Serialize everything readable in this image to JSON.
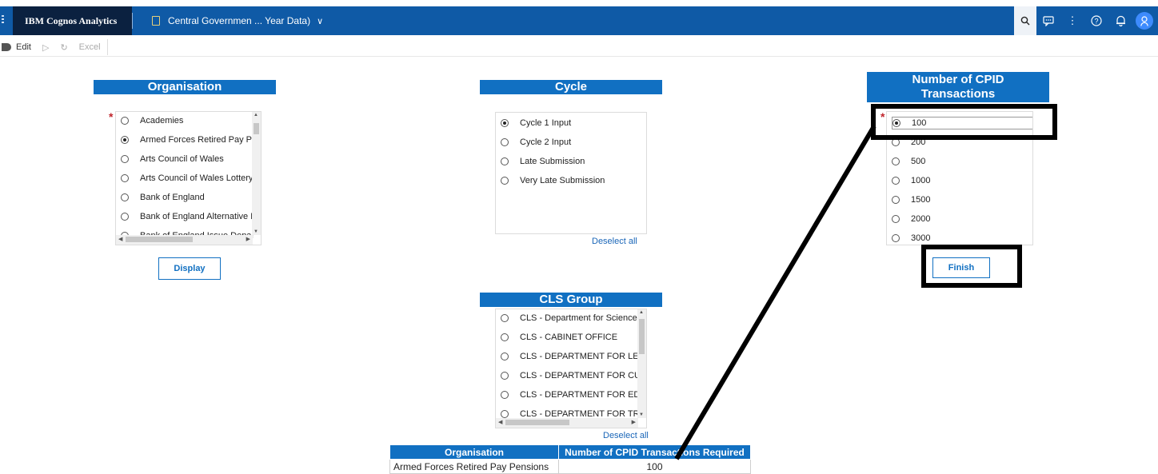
{
  "app": {
    "brand": "IBM Cognos Analytics",
    "report_title": "Central Governmen ... Year Data)"
  },
  "header_icons": [
    "search-icon",
    "comment-icon",
    "overflow-icon",
    "help-icon",
    "notification-icon",
    "user-icon"
  ],
  "toolbar": {
    "edit_label": "Edit",
    "excel_label": "Excel"
  },
  "organisation": {
    "title": "Organisation",
    "required_marker": "*",
    "options": [
      {
        "label": "Academies",
        "selected": false
      },
      {
        "label": "Armed Forces Retired Pay Pe",
        "selected": true
      },
      {
        "label": "Arts Council of Wales",
        "selected": false
      },
      {
        "label": "Arts Council of Wales Lottery",
        "selected": false
      },
      {
        "label": "Bank of England",
        "selected": false
      },
      {
        "label": "Bank of England Alternative L",
        "selected": false
      },
      {
        "label": "Bank of England Issue Depar",
        "selected": false
      }
    ],
    "display_button": "Display"
  },
  "cycle": {
    "title": "Cycle",
    "options": [
      {
        "label": "Cycle 1 Input",
        "selected": true
      },
      {
        "label": "Cycle 2 Input",
        "selected": false
      },
      {
        "label": "Late Submission",
        "selected": false
      },
      {
        "label": "Very Late Submission",
        "selected": false
      }
    ],
    "deselect_all": "Deselect all"
  },
  "cpid": {
    "title_line1": "Number of CPID",
    "title_line2": "Transactions",
    "required_marker": "*",
    "options": [
      {
        "label": "100",
        "selected": true
      },
      {
        "label": "200",
        "selected": false
      },
      {
        "label": "500",
        "selected": false
      },
      {
        "label": "1000",
        "selected": false
      },
      {
        "label": "1500",
        "selected": false
      },
      {
        "label": "2000",
        "selected": false
      },
      {
        "label": "3000",
        "selected": false
      }
    ],
    "finish_button": "Finish"
  },
  "cls_group": {
    "title": "CLS Group",
    "options": [
      {
        "label": "CLS - Department for Science,",
        "selected": false
      },
      {
        "label": "CLS - CABINET OFFICE",
        "selected": false
      },
      {
        "label": "CLS - DEPARTMENT FOR LEV",
        "selected": false
      },
      {
        "label": "CLS - DEPARTMENT FOR CUI",
        "selected": false
      },
      {
        "label": "CLS - DEPARTMENT FOR EDI",
        "selected": false
      },
      {
        "label": "CLS - DEPARTMENT FOR TRA",
        "selected": false
      }
    ],
    "deselect_all": "Deselect all"
  },
  "result_table": {
    "headers": [
      "Organisation",
      "Number of CPID Transactions Required"
    ],
    "rows": [
      [
        "Armed Forces Retired Pay Pensions",
        "100"
      ]
    ]
  }
}
